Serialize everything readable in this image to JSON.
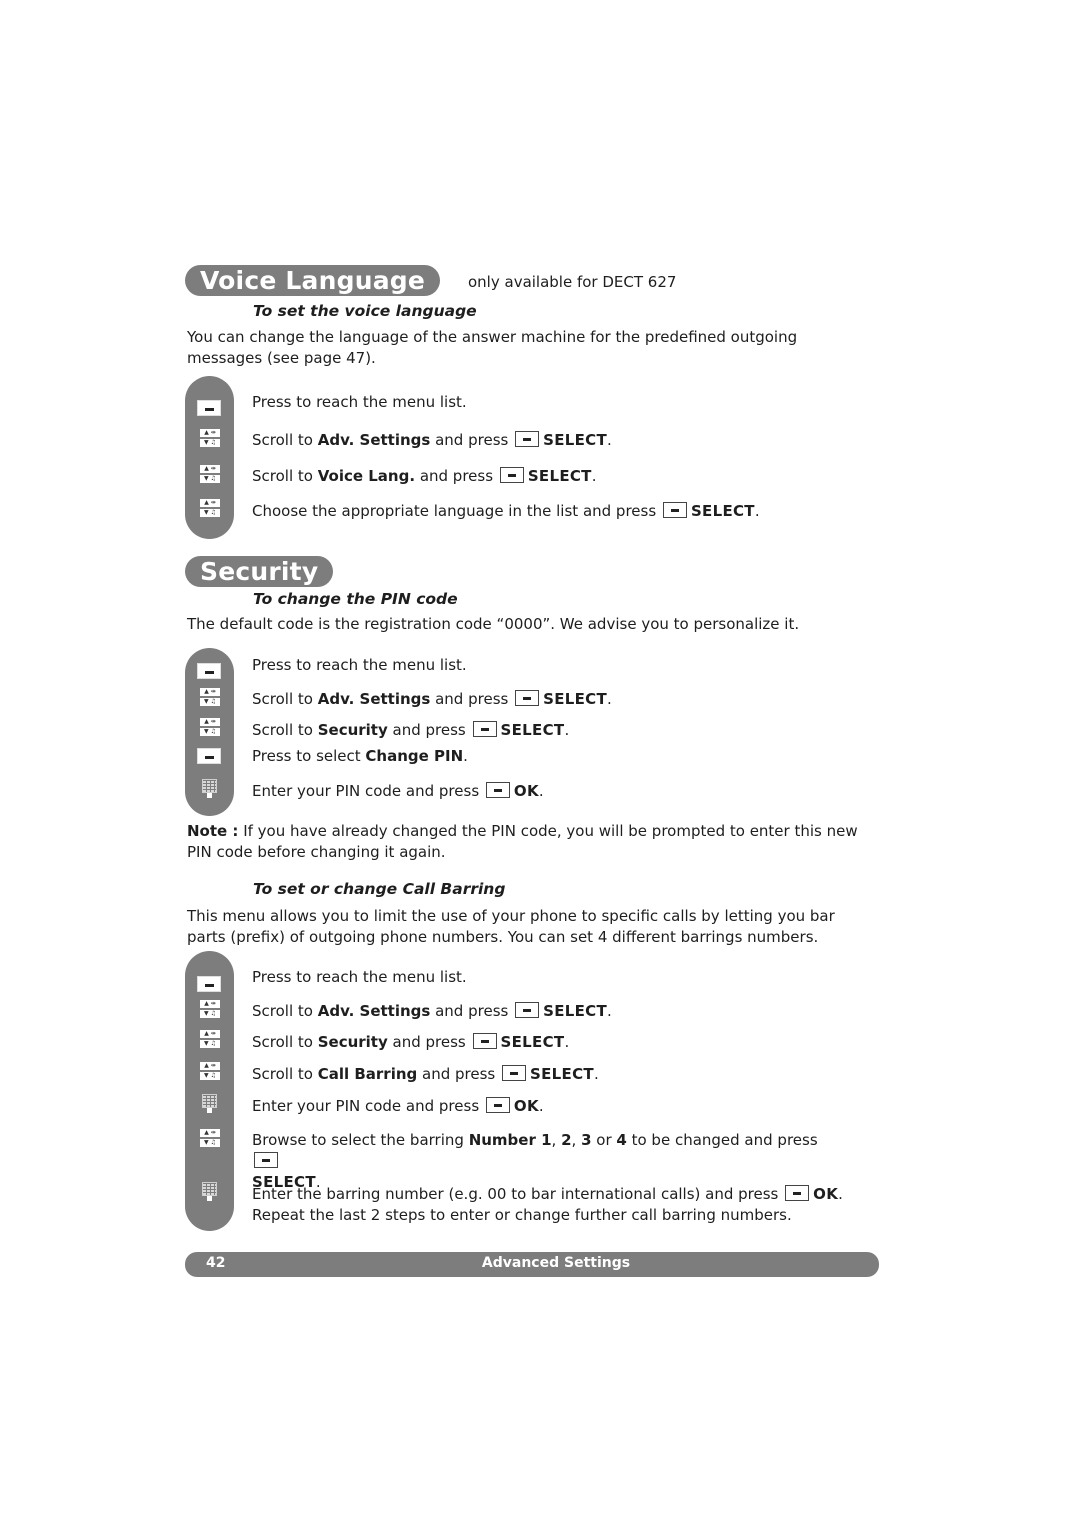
{
  "voice_language": {
    "title": "Voice Language",
    "availability": "only available for DECT 627",
    "subtitle": "To set the voice language",
    "intro": "You can change the language of the answer machine for the predefined outgoing messages (see page 47).",
    "steps": [
      {
        "icon": "menu-key",
        "pre": "Press to reach the menu list.",
        "bold": "",
        "post": "",
        "key": "",
        "action": ""
      },
      {
        "icon": "nav-key",
        "pre": "Scroll to ",
        "bold": "Adv. Settings",
        "post": " and press",
        "key": "menu-key",
        "action": "SELECT"
      },
      {
        "icon": "nav-key",
        "pre": "Scroll to ",
        "bold": "Voice Lang.",
        "post": " and press",
        "key": "menu-key",
        "action": "SELECT"
      },
      {
        "icon": "nav-key",
        "pre": "Choose the appropriate language in the list and press",
        "bold": "",
        "post": "",
        "key": "menu-key",
        "action": "SELECT"
      }
    ]
  },
  "security": {
    "title": "Security",
    "pin": {
      "subtitle": "To change the PIN code",
      "intro": "The default code is the registration code “0000”. We advise you to personalize it.",
      "steps": [
        {
          "icon": "menu-key",
          "pre": "Press to reach the menu list.",
          "bold": "",
          "post": "",
          "key": "",
          "action": ""
        },
        {
          "icon": "nav-key",
          "pre": "Scroll to ",
          "bold": "Adv. Settings",
          "post": " and press",
          "key": "menu-key",
          "action": "SELECT"
        },
        {
          "icon": "nav-key",
          "pre": "Scroll to ",
          "bold": "Security",
          "post": " and press",
          "key": "menu-key",
          "action": "SELECT"
        },
        {
          "icon": "menu-key",
          "pre": "Press to select ",
          "bold": "Change PIN",
          "post": ".",
          "key": "",
          "action": ""
        },
        {
          "icon": "keypad",
          "pre": "Enter your PIN code and press",
          "bold": "",
          "post": "",
          "key": "menu-key",
          "action": "OK"
        }
      ],
      "note_label": "Note :",
      "note_text": " If you have already changed the PIN code, you will be prompted to enter this new PIN code before changing it again."
    },
    "barring": {
      "subtitle": "To set or change Call Barring",
      "intro": "This menu allows you to limit the use of your phone to specific calls by letting you bar parts (prefix) of outgoing phone numbers. You can set 4 different barrings numbers.",
      "steps": [
        {
          "icon": "menu-key",
          "pre": "Press to reach the menu list.",
          "bold": "",
          "post": "",
          "key": "",
          "action": ""
        },
        {
          "icon": "nav-key",
          "pre": "Scroll to ",
          "bold": "Adv. Settings",
          "post": " and press",
          "key": "menu-key",
          "action": "SELECT"
        },
        {
          "icon": "nav-key",
          "pre": "Scroll to ",
          "bold": "Security",
          "post": " and press",
          "key": "menu-key",
          "action": "SELECT"
        },
        {
          "icon": "nav-key",
          "pre": "Scroll to ",
          "bold": "Call Barring",
          "post": " and press",
          "key": "menu-key",
          "action": "SELECT"
        },
        {
          "icon": "keypad",
          "pre": "Enter your PIN code and press",
          "bold": "",
          "post": "",
          "key": "menu-key",
          "action": "OK"
        }
      ],
      "browse_step": {
        "icon": "nav-key",
        "pre": "Browse to select the barring ",
        "b1": "Number 1",
        "c1": ", ",
        "b2": "2",
        "c2": ", ",
        "b3": "3",
        "c3": " or ",
        "b4": "4",
        "post": " to be changed and press",
        "key": "menu-key",
        "action": "SELECT"
      },
      "enter_step": {
        "icon": "keypad",
        "pre": "Enter the barring number (e.g. 00 to bar international calls) and press",
        "key": "menu-key",
        "action": "OK",
        "line2": "Repeat the last 2 steps to enter or change further call barring numbers."
      }
    }
  },
  "footer": {
    "page_number": "42",
    "section": "Advanced Settings"
  }
}
